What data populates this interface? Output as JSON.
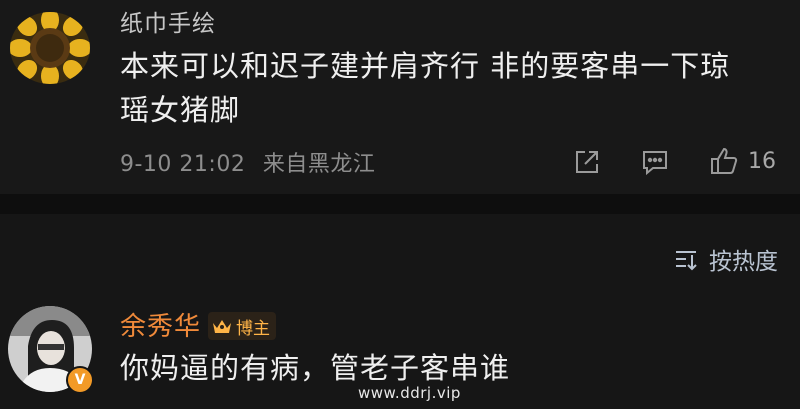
{
  "comments": [
    {
      "username": "纸巾手绘",
      "text": "本来可以和迟子建并肩齐行 非的要客串一下琼瑶女猪脚",
      "time": "9-10 21:02",
      "location": "来自黑龙江",
      "like_count": "16"
    },
    {
      "username": "余秀华",
      "badge": "博主",
      "text": "你妈逼的有病，管老子客串谁"
    }
  ],
  "sort": {
    "label": "按热度"
  },
  "watermark": "www.ddrj.vip",
  "icons": {
    "share": "share-icon",
    "reply": "comment-icon",
    "like": "thumbs-up-icon",
    "sort": "sort-icon",
    "badge": "crown-icon",
    "verified": "verified-v-icon"
  },
  "colors": {
    "background": "#161616",
    "username_highlight": "#f08a3a",
    "badge": "#ffb447",
    "verified": "#f29a27"
  }
}
